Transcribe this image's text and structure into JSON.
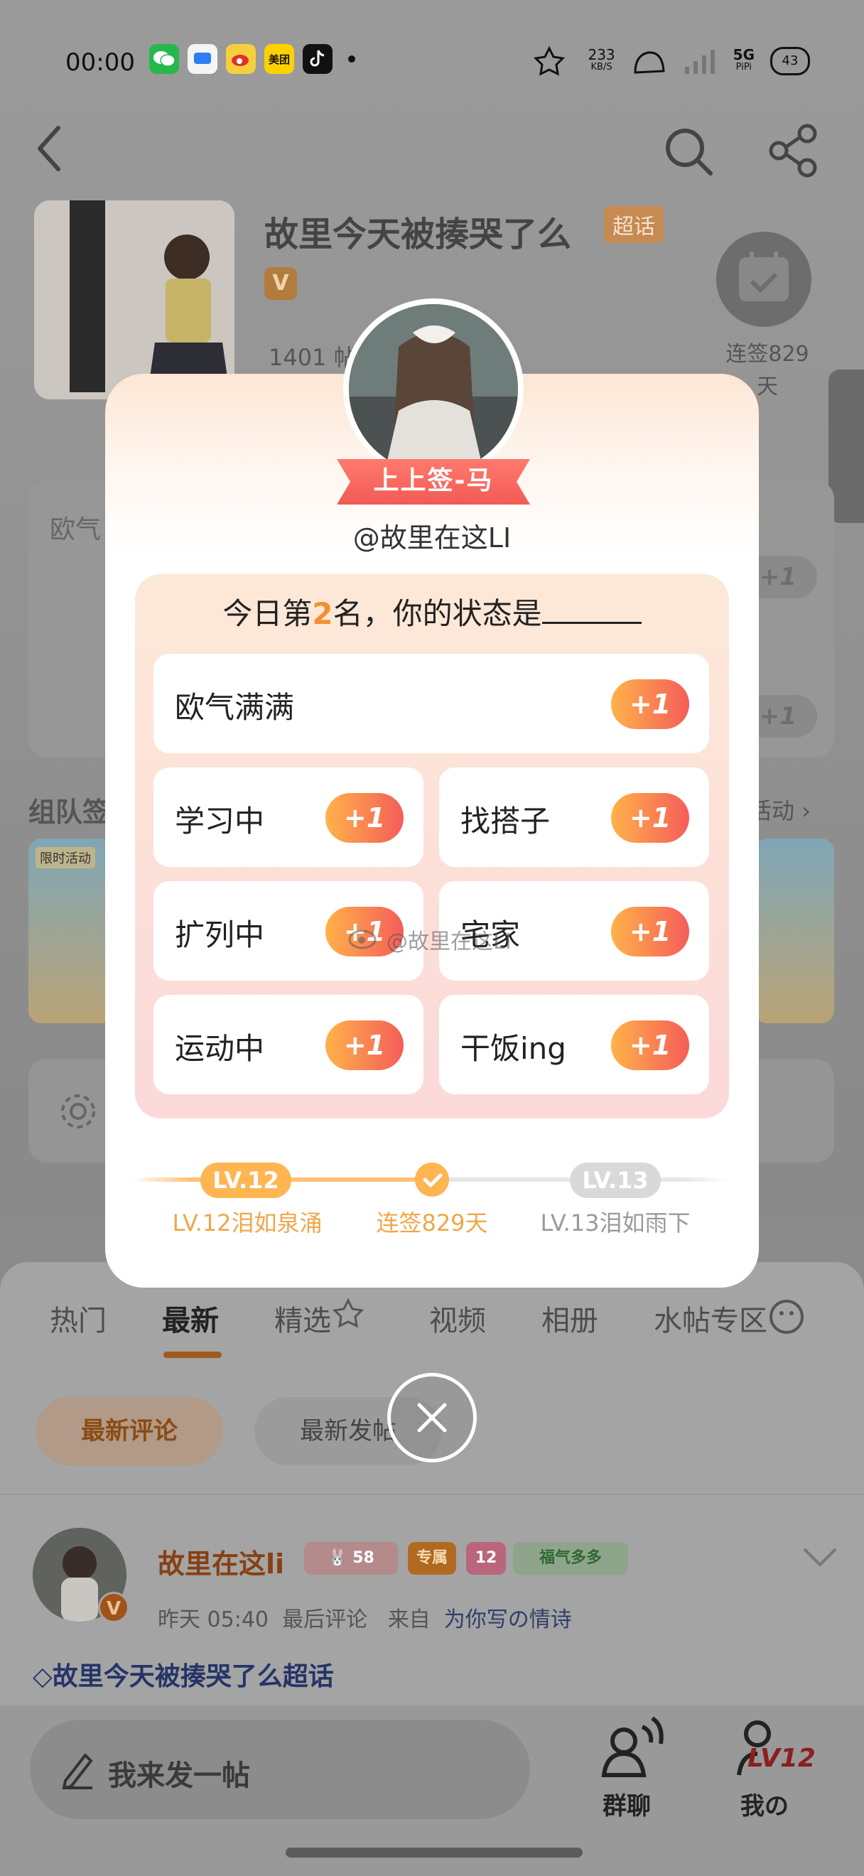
{
  "status_bar": {
    "time": "00:00",
    "apps": [
      "wechat-icon",
      "messages-icon",
      "weibo-icon",
      "美团",
      "tiktok-icon"
    ],
    "network_speed_value": "233",
    "network_speed_unit": "KB/S",
    "network_type": "5G",
    "network_sub": "PiPi",
    "battery_level": "43"
  },
  "nav": {
    "back": "back-icon",
    "search": "search-icon",
    "share": "share-icon"
  },
  "topic": {
    "title": "故里今天被揍哭了么",
    "super_tag": "超话",
    "v_badge": "V",
    "stats": "1401 帖",
    "checkin_line1": "连签829",
    "checkin_line2": "天"
  },
  "background": {
    "card_label": "欧气",
    "plus_one": "+1",
    "team_label": "组队签",
    "activity_link": "活动",
    "limited_tag": "限时活动"
  },
  "modal": {
    "fortune_ribbon": "上上签-马",
    "username": "@故里在这LI",
    "status_prefix": "今日第",
    "rank": "2",
    "status_suffix": "名，你的状态是",
    "options": [
      {
        "label": "欧气满满",
        "action": "+1"
      },
      {
        "label": "学习中",
        "action": "+1"
      },
      {
        "label": "找搭子",
        "action": "+1"
      },
      {
        "label": "扩列中",
        "action": "+1"
      },
      {
        "label": "宅家",
        "action": "+1"
      },
      {
        "label": "运动中",
        "action": "+1"
      },
      {
        "label": "干饭ing",
        "action": "+1"
      }
    ],
    "watermark": "@故里在这LI",
    "level_current": "LV.12",
    "level_next": "LV.13",
    "level_current_caption": "LV.12泪如泉涌",
    "checkin_caption": "连签829天",
    "level_next_caption": "LV.13泪如雨下",
    "accent_color": "#ffb552",
    "plus_gradient_end": "#f45d59"
  },
  "sheet": {
    "tabs": [
      "热门",
      "最新",
      "精选",
      "视频",
      "相册",
      "水帖专区"
    ],
    "active_tab": "最新",
    "filters": [
      "最新评论",
      "最新发帖"
    ]
  },
  "post": {
    "author": "故里在这li",
    "badge_level": "58",
    "badge_exclusive": "专属",
    "badge_lv": "12",
    "badge_fortune": "福气多多",
    "v_badge": "V",
    "time": "昨天 05:40",
    "meta_action": "最后评论",
    "from_label": "来自",
    "source": "为你写の情诗",
    "topic_link": "故里今天被揍哭了么超话"
  },
  "bottom_bar": {
    "compose_placeholder": "我来发一帖",
    "group_chat": "群聊",
    "me": "我の",
    "me_level": "LV12"
  }
}
